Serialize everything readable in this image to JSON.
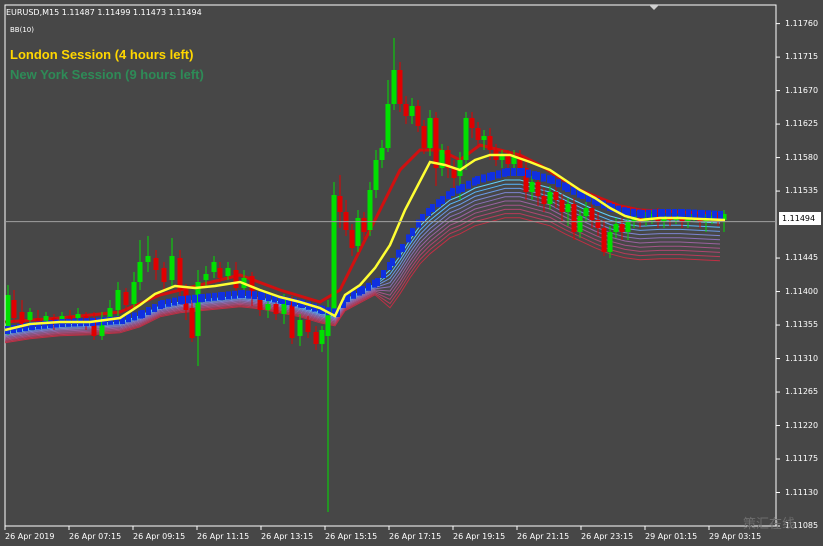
{
  "header": {
    "symbol_line": "EURUSD,M15  1.11487 1.11499 1.11473 1.11494",
    "indicator": "BB(10)"
  },
  "sessions": {
    "london": "London Session (4 hours left)",
    "newyork": "New York Session (9 hours left)"
  },
  "current_price": "1.11494",
  "watermark": "策汇在线",
  "colors": {
    "background": "#474747",
    "bull": "#00e000",
    "bear": "#e00000",
    "ema": "#ffff33",
    "blue": "#1030e0",
    "current_line": "#9a9a9a"
  },
  "chart_data": {
    "type": "candlestick",
    "timeframe": "M15",
    "y_ticks": [
      "1.11760",
      "1.11715",
      "1.11670",
      "1.11625",
      "1.11580",
      "1.11535",
      "1.11445",
      "1.11400",
      "1.11355",
      "1.11310",
      "1.11265",
      "1.11220",
      "1.11175",
      "1.11130",
      "1.11085"
    ],
    "x_ticks": [
      "26 Apr 2019",
      "26 Apr 07:15",
      "26 Apr 09:15",
      "26 Apr 11:15",
      "26 Apr 13:15",
      "26 Apr 15:15",
      "26 Apr 17:15",
      "26 Apr 19:15",
      "26 Apr 21:15",
      "26 Apr 23:15",
      "29 Apr 01:15",
      "29 Apr 03:15"
    ],
    "ylim": [
      1.11085,
      1.11785
    ],
    "last_price": 1.11494
  }
}
